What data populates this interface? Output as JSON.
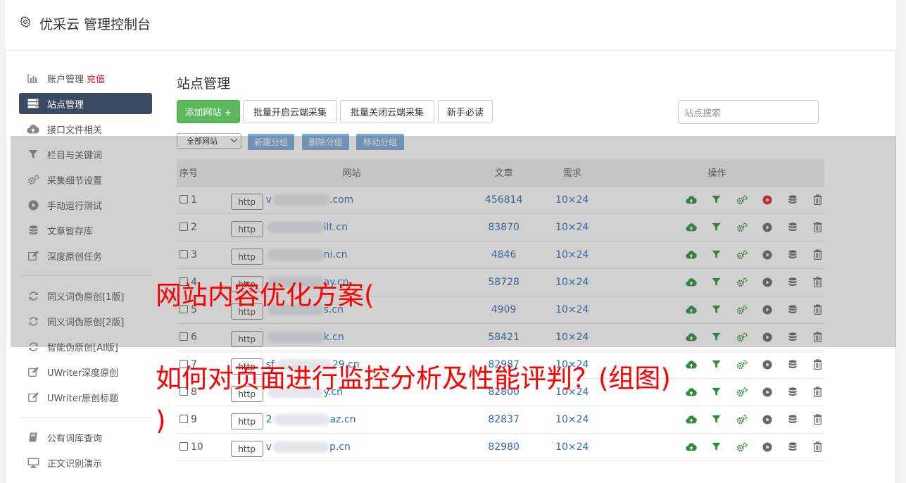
{
  "header": {
    "title": "优采云 管理控制台",
    "icon": "gear-icon"
  },
  "sidebar": {
    "items": [
      {
        "label": "账户管理",
        "extra": "充值",
        "icon": "bar-chart-icon"
      },
      {
        "label": "站点管理",
        "icon": "server-icon",
        "active": true
      },
      {
        "label": "接口文件相关",
        "icon": "cloud-upload-icon"
      },
      {
        "label": "栏目与关键词",
        "icon": "filter-icon"
      },
      {
        "label": "采集细节设置",
        "icon": "gears-icon"
      },
      {
        "label": "手动运行测试",
        "icon": "play-circle-icon"
      },
      {
        "label": "文章暂存库",
        "icon": "database-icon"
      },
      {
        "label": "深度原创任务",
        "icon": "edit-icon"
      }
    ],
    "items2": [
      {
        "label": "同义词伪原创[1版]",
        "icon": "refresh-icon"
      },
      {
        "label": "同义词伪原创[2版]",
        "icon": "refresh-icon"
      },
      {
        "label": "智能伪原创[AI版]",
        "icon": "refresh-icon"
      },
      {
        "label": "UWriter深度原创",
        "icon": "edit-icon"
      },
      {
        "label": "UWriter原创标题",
        "icon": "edit-icon"
      }
    ],
    "items3": [
      {
        "label": "公有词库查询",
        "icon": "book-icon"
      },
      {
        "label": "正文识别演示",
        "icon": "monitor-icon"
      }
    ]
  },
  "main": {
    "title": "站点管理",
    "toolbar": {
      "add": "添加网站 +",
      "enable_all": "批量开启云端采集",
      "disable_all": "批量关闭云端采集",
      "guide": "新手必读",
      "search_placeholder": "站点搜索"
    },
    "group_select": "全部网站",
    "group_buttons": {
      "new": "新建分组",
      "delete": "删除分组",
      "move": "移动分组"
    },
    "table": {
      "headers": {
        "no": "序号",
        "site": "网站",
        "articles": "文章",
        "demand": "需求",
        "ops": "操作"
      },
      "protocol": "http",
      "rows": [
        {
          "no": "1",
          "domain_prefix": "v",
          "domain_suffix": ".com",
          "articles": "456814",
          "demand": "10×24",
          "run_active": true
        },
        {
          "no": "2",
          "domain_prefix": "",
          "domain_suffix": "ilt.cn",
          "articles": "83870",
          "demand": "10×24"
        },
        {
          "no": "3",
          "domain_prefix": "",
          "domain_suffix": "ni.cn",
          "articles": "4846",
          "demand": "10×24"
        },
        {
          "no": "4",
          "domain_prefix": "",
          "domain_suffix": "ay.cn",
          "articles": "58728",
          "demand": "10×24"
        },
        {
          "no": "5",
          "domain_prefix": "",
          "domain_suffix": "s.cn",
          "articles": "4909",
          "demand": "10×24"
        },
        {
          "no": "6",
          "domain_prefix": "",
          "domain_suffix": "k.cn",
          "articles": "58421",
          "demand": "10×24"
        },
        {
          "no": "7",
          "domain_prefix": "sf",
          "domain_suffix": "29.cn",
          "articles": "82987",
          "demand": "10×24"
        },
        {
          "no": "8",
          "domain_prefix": "",
          "domain_suffix": "y.cn",
          "articles": "82800",
          "demand": "10×24"
        },
        {
          "no": "9",
          "domain_prefix": "2",
          "domain_suffix": "az.cn",
          "articles": "82837",
          "demand": "10×24"
        },
        {
          "no": "10",
          "domain_prefix": "v",
          "domain_suffix": "p.cn",
          "articles": "82980",
          "demand": "10×24"
        }
      ]
    }
  },
  "watermark": {
    "line1": "网站内容优化方案(",
    "line2": "如何对页面进行监控分析及性能评判？(组图)",
    "line3": ")"
  },
  "colors": {
    "accent": "#3a4a63",
    "green": "#5cb85c",
    "link": "#2f6bb0",
    "watermark": "#ff0000"
  }
}
